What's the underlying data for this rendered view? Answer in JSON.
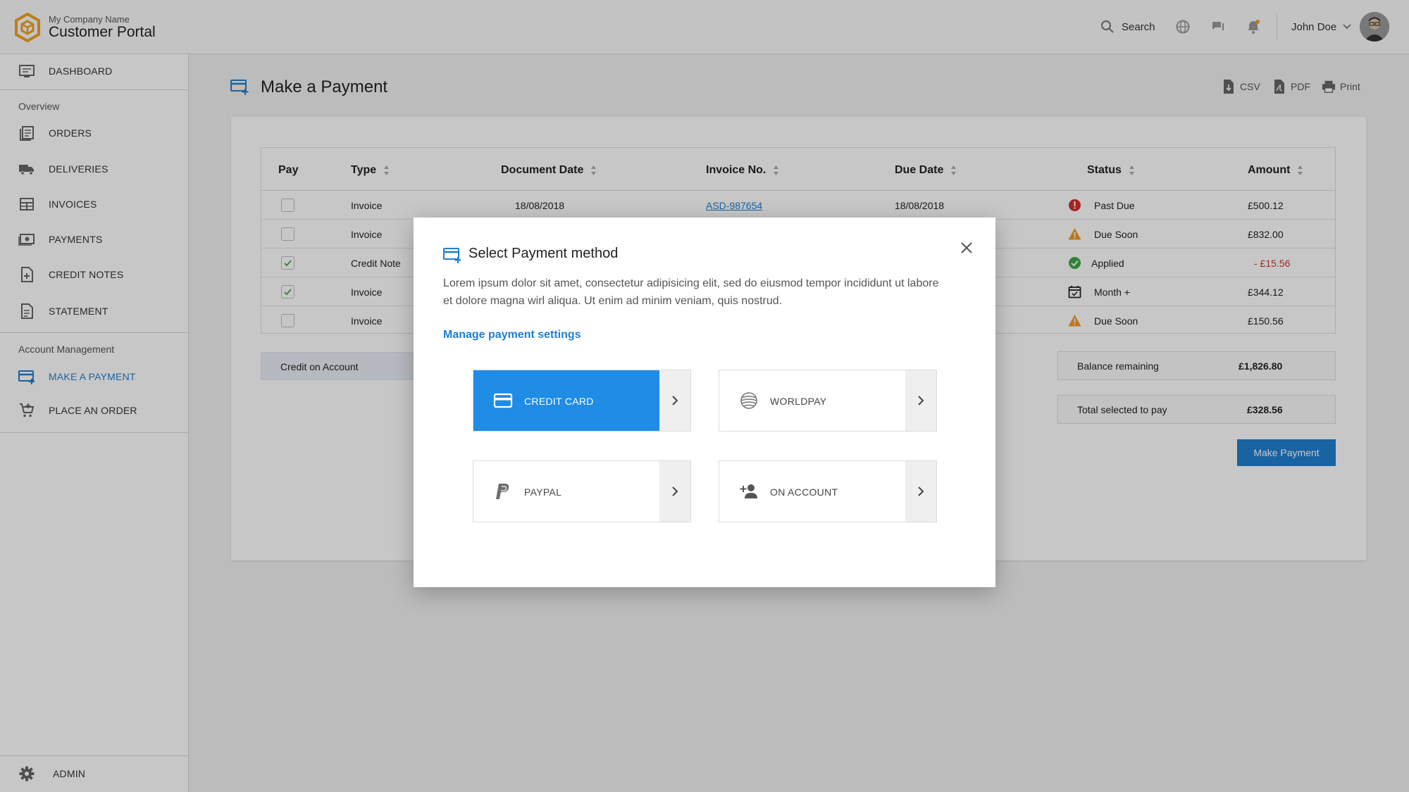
{
  "header": {
    "company": "My Company Name",
    "portal": "Customer Portal",
    "search_label": "Search",
    "user_name": "John Doe"
  },
  "sidebar": {
    "dashboard": "DASHBOARD",
    "overview_title": "Overview",
    "orders": "ORDERS",
    "deliveries": "DELIVERIES",
    "invoices": "INVOICES",
    "payments": "PAYMENTS",
    "credit_notes": "CREDIT NOTES",
    "statement": "STATEMENT",
    "account_title": "Account Management",
    "make_payment": "MAKE A PAYMENT",
    "place_order": "PLACE AN ORDER",
    "admin": "ADMIN"
  },
  "page": {
    "title": "Make a Payment",
    "csv": "CSV",
    "pdf": "PDF",
    "print": "Print"
  },
  "table": {
    "headers": {
      "pay": "Pay",
      "type": "Type",
      "document_date": "Document Date",
      "invoice_no": "Invoice No.",
      "due_date": "Due Date",
      "status": "Status",
      "amount": "Amount"
    },
    "rows": [
      {
        "type": "Invoice",
        "document_date": "18/08/2018",
        "invoice_no": "ASD-987654",
        "due_date": "18/08/2018",
        "status": "Past Due",
        "amount": "£500.12"
      },
      {
        "type": "Invoice",
        "status": "Due Soon",
        "amount": "£832.00"
      },
      {
        "type": "Credit Note",
        "status": "Applied",
        "amount": "- £15.56"
      },
      {
        "type": "Invoice",
        "status": "Month +",
        "amount": "£344.12"
      },
      {
        "type": "Invoice",
        "status": "Due Soon",
        "amount": "£150.56"
      }
    ]
  },
  "credit_on_account": "Credit on Account",
  "summary": {
    "balance_label": "Balance remaining",
    "balance_value": "£1,826.80",
    "selected_label": "Total selected to pay",
    "selected_value": "£328.56"
  },
  "make_payment_button": "Make Payment",
  "modal": {
    "title": "Select Payment method",
    "body": "Lorem ipsum dolor sit amet, consectetur adipisicing elit, sed do eiusmod tempor incididunt ut labore et dolore magna wirl aliqua. Ut enim ad minim veniam, quis nostrud.",
    "link": "Manage payment settings",
    "methods": {
      "credit_card": "CREDIT CARD",
      "worldpay": "WORLDPAY",
      "paypal": "PAYPAL",
      "on_account": "ON ACCOUNT"
    }
  },
  "colors": {
    "accent": "#1f7fd0",
    "selected_method": "#1f8ce6",
    "past_due": "#d32f2f",
    "due_soon": "#f29a1f",
    "applied": "#3aa845",
    "logo": "#f2a11f"
  }
}
